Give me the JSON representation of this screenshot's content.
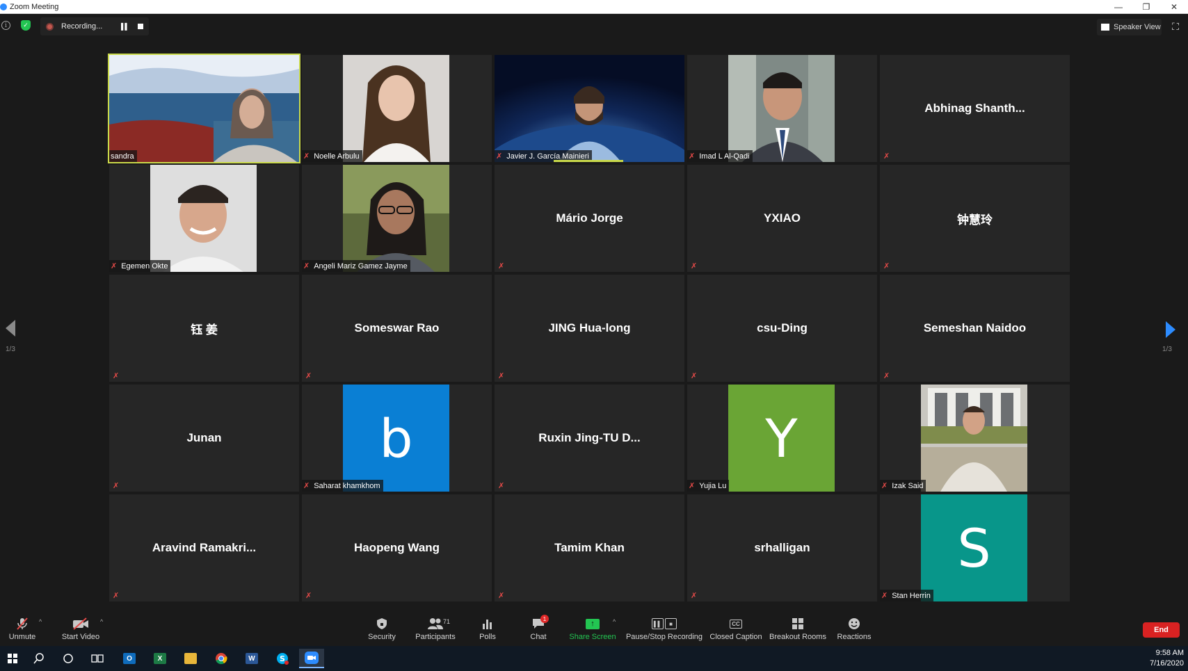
{
  "window": {
    "title": "Zoom Meeting",
    "controls": [
      "—",
      "❐",
      "✕"
    ]
  },
  "topbar": {
    "info": "i",
    "recording_label": "Recording...",
    "speaker_view_label": "Speaker View"
  },
  "pager": {
    "left": "1/3",
    "right": "1/3"
  },
  "colors": {
    "active_speaker": "#c9d94a",
    "muted_mic": "#e34a48",
    "share_green": "#23c552",
    "end_red": "#d92222"
  },
  "tiles": [
    {
      "name": "sandra",
      "type": "video",
      "active": true,
      "muted": false
    },
    {
      "name": "Noelle Arbulu",
      "type": "video",
      "muted": true
    },
    {
      "name": "Javier J. García Mainieri",
      "type": "video",
      "muted": true
    },
    {
      "name": "Imad L Al-Qadi",
      "type": "video",
      "muted": true
    },
    {
      "name": "Abhinag  Shanth...",
      "type": "name",
      "muted": true
    },
    {
      "name": "Egemen Okte",
      "type": "video",
      "muted": true
    },
    {
      "name": "Angeli Mariz Gamez Jayme",
      "type": "video",
      "muted": true
    },
    {
      "name": "Mário Jorge",
      "type": "name",
      "muted": true
    },
    {
      "name": "YXIAO",
      "type": "name",
      "muted": true
    },
    {
      "name": "钟慧玲",
      "type": "name",
      "muted": true
    },
    {
      "name": "钰 姜",
      "type": "name",
      "muted": true
    },
    {
      "name": "Someswar Rao",
      "type": "name",
      "muted": true
    },
    {
      "name": "JING Hua-long",
      "type": "name",
      "muted": true
    },
    {
      "name": "csu-Ding",
      "type": "name",
      "muted": true
    },
    {
      "name": "Semeshan Naidoo",
      "type": "name",
      "muted": true
    },
    {
      "name": "Junan",
      "type": "name",
      "muted": true
    },
    {
      "name": "Saharat khamkhom",
      "type": "avatar",
      "letter": "b",
      "color": "#0a7fd4",
      "muted": true
    },
    {
      "name": "Ruxin Jing-TU  D...",
      "type": "name",
      "muted": true
    },
    {
      "name": "Yujia Lu",
      "type": "avatar",
      "letter": "Y",
      "color": "#6aa535",
      "muted": true
    },
    {
      "name": "Izak Said",
      "type": "video",
      "muted": true
    },
    {
      "name": "Aravind  Ramakri...",
      "type": "name",
      "muted": true
    },
    {
      "name": "Haopeng Wang",
      "type": "name",
      "muted": true
    },
    {
      "name": "Tamim Khan",
      "type": "name",
      "muted": true
    },
    {
      "name": "srhalligan",
      "type": "name",
      "muted": true
    },
    {
      "name": "Stan Herrin",
      "type": "avatar",
      "letter": "S",
      "color": "#08968a",
      "muted": true
    }
  ],
  "toolbar": {
    "unmute": "Unmute",
    "start_video": "Start Video",
    "security": "Security",
    "participants": "Participants",
    "participants_count": "71",
    "polls": "Polls",
    "chat": "Chat",
    "chat_badge": "1",
    "share_screen": "Share Screen",
    "pause_stop_recording": "Pause/Stop Recording",
    "closed_caption": "Closed Caption",
    "cc_glyph": "CC",
    "breakout_rooms": "Breakout Rooms",
    "reactions": "Reactions",
    "end": "End"
  },
  "taskbar": {
    "time": "9:58 AM",
    "date": "7/16/2020"
  }
}
